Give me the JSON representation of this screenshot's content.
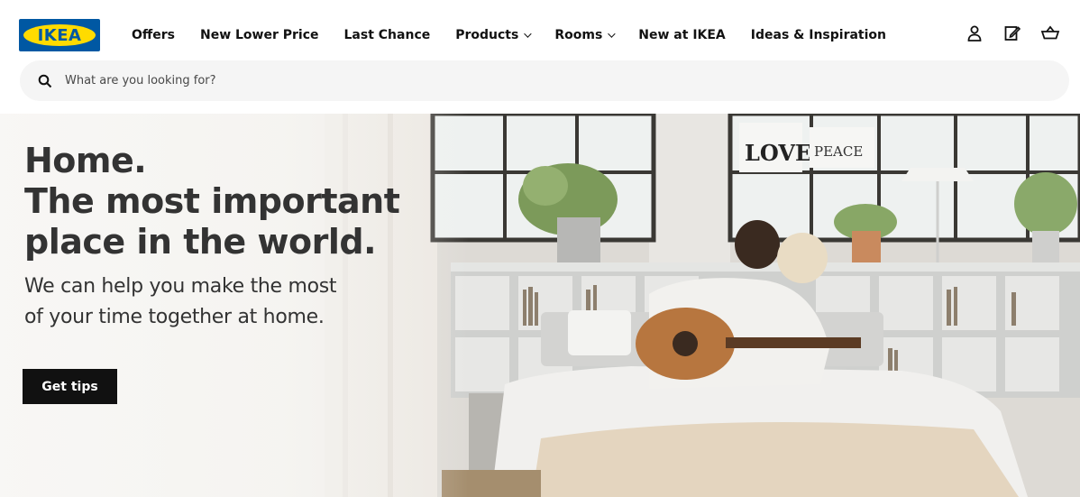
{
  "header": {
    "logo_text": "IKEA",
    "nav": [
      {
        "label": "Offers",
        "has_dropdown": false
      },
      {
        "label": "New Lower Price",
        "has_dropdown": false
      },
      {
        "label": "Last Chance",
        "has_dropdown": false
      },
      {
        "label": "Products",
        "has_dropdown": true
      },
      {
        "label": "Rooms",
        "has_dropdown": true
      },
      {
        "label": "New at IKEA",
        "has_dropdown": false
      },
      {
        "label": "Ideas & Inspiration",
        "has_dropdown": false
      }
    ],
    "icons": [
      "account-icon",
      "shopping-list-icon",
      "cart-icon"
    ]
  },
  "search": {
    "placeholder": "What are you looking for?",
    "value": "",
    "icon": "search-icon"
  },
  "hero": {
    "title_line_1": "Home.",
    "title_line_2": "The most important",
    "title_line_3": "place in the world.",
    "subtitle_line_1": "We can help you make the most",
    "subtitle_line_2": "of your time together at home.",
    "button_label": "Get tips",
    "wall_sign_1": "LOVE",
    "wall_sign_2": "PEACE"
  },
  "colors": {
    "brand_blue": "#0058a3",
    "brand_yellow": "#ffdb00",
    "button_black": "#111111",
    "search_bg": "#f5f5f5"
  }
}
